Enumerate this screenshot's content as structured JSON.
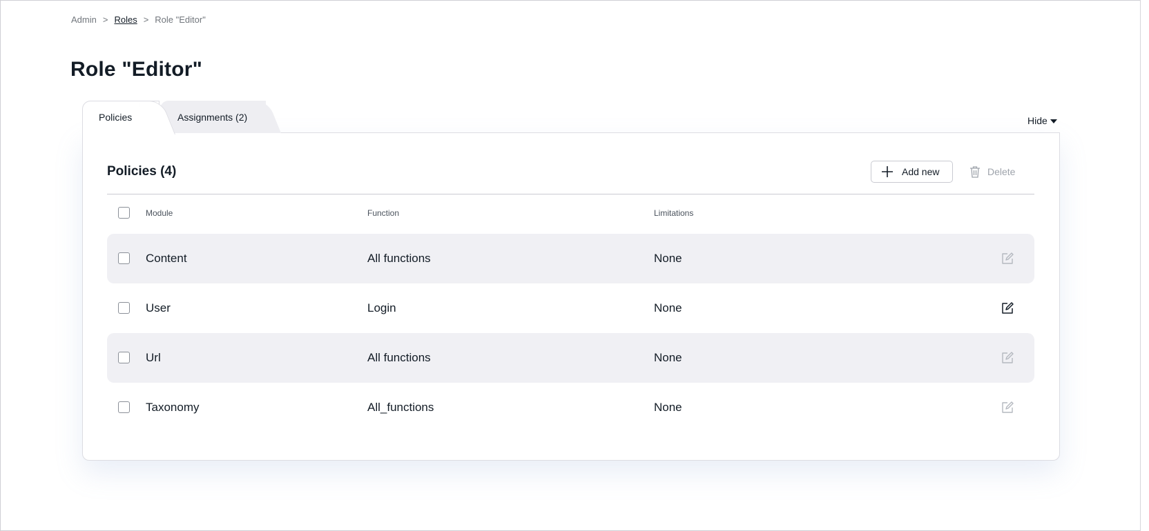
{
  "breadcrumb": {
    "items": [
      "Admin",
      "Roles",
      "Role \"Editor\""
    ],
    "separator": ">"
  },
  "page_title": "Role \"Editor\"",
  "tabs": [
    {
      "label": "Policies",
      "active": true
    },
    {
      "label": "Assignments (2)",
      "active": false
    }
  ],
  "hide_toggle": "Hide",
  "policies": {
    "title": "Policies (4)",
    "add_label": "Add new",
    "delete_label": "Delete",
    "columns": [
      "Module",
      "Function",
      "Limitations"
    ],
    "rows": [
      {
        "module": "Content",
        "function": "All functions",
        "limitations": "None",
        "shaded": true,
        "edit_enabled": false
      },
      {
        "module": "User",
        "function": "Login",
        "limitations": "None",
        "shaded": false,
        "edit_enabled": true
      },
      {
        "module": "Url",
        "function": "All functions",
        "limitations": "None",
        "shaded": true,
        "edit_enabled": false
      },
      {
        "module": "Taxonomy",
        "function": "All_functions",
        "limitations": "None",
        "shaded": false,
        "edit_enabled": false
      }
    ]
  },
  "colors": {
    "text": "#131c26",
    "muted": "#9ea3ab",
    "row_shade": "#f0f0f4",
    "border": "#dcdce2"
  },
  "icons": {
    "add": "plus-icon",
    "delete": "trash-icon",
    "edit": "edit-icon",
    "hide": "caret-down-icon"
  }
}
